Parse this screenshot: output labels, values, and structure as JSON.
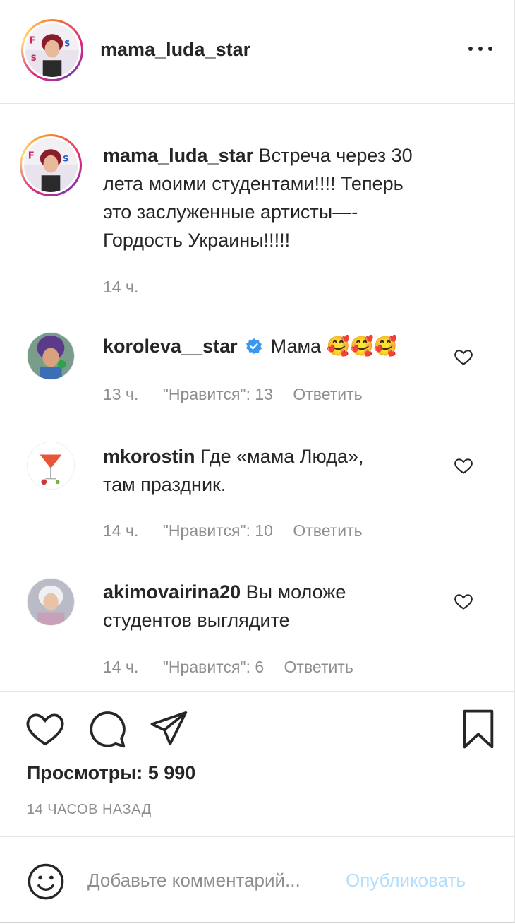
{
  "post": {
    "author": "mama_luda_star",
    "caption": {
      "username": "mama_luda_star",
      "lines": [
        "Встреча через 30",
        "лета моими студентами!!!! Теперь",
        "это заслуженные артисты—-",
        "Гордость Украины!!!!!"
      ],
      "time": "14 ч."
    },
    "comments": [
      {
        "username": "koroleva__star",
        "verified": true,
        "text": "Мама 🥰🥰🥰",
        "time": "13 ч.",
        "likes": "\"Нравится\": 13",
        "reply": "Ответить"
      },
      {
        "username": "mkorostin",
        "verified": false,
        "text_line1": "Где «мама Люда»,",
        "text_line2": "там праздник.",
        "time": "14 ч.",
        "likes": "\"Нравится\": 10",
        "reply": "Ответить"
      },
      {
        "username": "akimovairina20",
        "verified": false,
        "text_line1": "Вы моложе",
        "text_line2": "студентов выглядите",
        "time": "14 ч.",
        "likes": "\"Нравится\": 6",
        "reply": "Ответить"
      }
    ],
    "views": "Просмотры: 5 990",
    "posted_ago": "14 ЧАСОВ НАЗАД",
    "comment_box": {
      "placeholder": "Добавьте комментарий...",
      "publish_label": "Опубликовать"
    }
  },
  "icons": {
    "more": "more-dots-icon",
    "like": "heart-icon",
    "comment": "comment-bubble-icon",
    "share": "paper-plane-icon",
    "save": "bookmark-icon",
    "emoji": "smiley-icon",
    "verified": "verified-badge-icon"
  },
  "colors": {
    "text": "#262626",
    "muted": "#8e8e8e",
    "verified": "#3897f0",
    "publish_disabled": "#b2dffc",
    "divider": "#e4e4e4"
  }
}
